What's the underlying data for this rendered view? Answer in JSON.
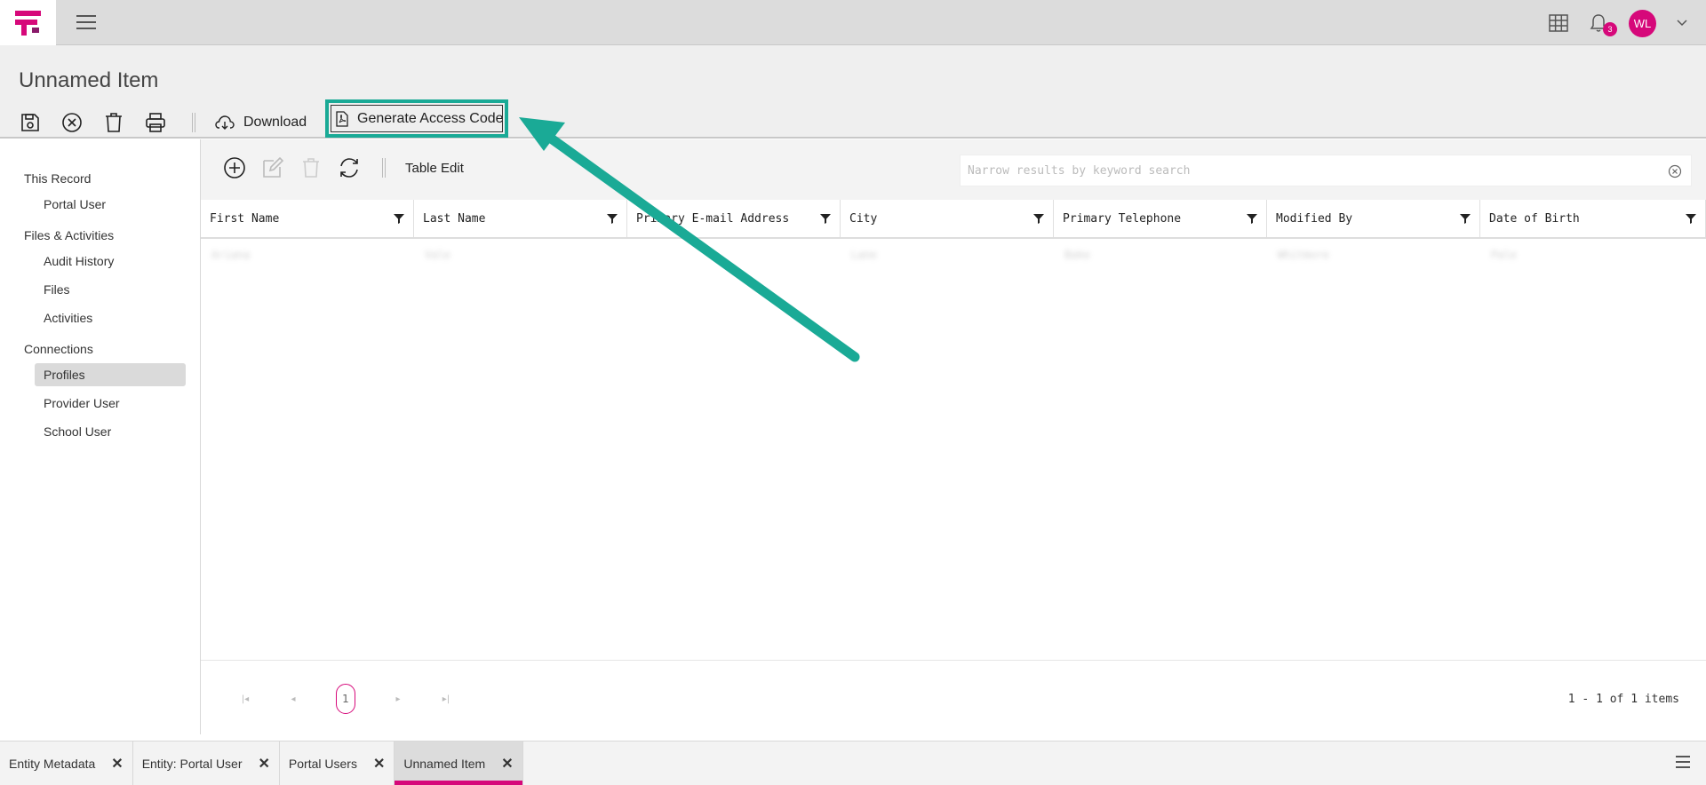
{
  "app": {
    "notification_count": "3",
    "user_initials": "WL",
    "accent_color": "#d6087a",
    "highlight_color": "#1aaa96"
  },
  "header": {
    "title": "Unnamed Item",
    "toolbar": {
      "icons": [
        "save-icon",
        "cancel-icon",
        "delete-icon",
        "print-icon"
      ],
      "download_label": "Download",
      "generate_label": "Generate Access Code"
    }
  },
  "sidebar": {
    "groups": [
      {
        "label": "This Record",
        "items": [
          "Portal User"
        ]
      },
      {
        "label": "Files & Activities",
        "items": [
          "Audit History",
          "Files",
          "Activities"
        ]
      },
      {
        "label": "Connections",
        "items": [
          "Profiles",
          "Provider User",
          "School User"
        ]
      }
    ],
    "active_item": "Profiles"
  },
  "grid": {
    "toolbar": {
      "icons": [
        "add-icon",
        "edit-icon",
        "delete-icon",
        "refresh-icon"
      ],
      "table_edit_label": "Table Edit"
    },
    "search": {
      "placeholder": "Narrow results by keyword search",
      "value": ""
    },
    "columns": [
      "First Name",
      "Last Name",
      "Primary E-mail Address",
      "City",
      "Primary Telephone",
      "Modified By",
      "Date of Birth"
    ],
    "rows": [
      [
        "Ariana",
        "Vale",
        "",
        "Lane",
        "Bake",
        "Whitmore",
        "Pale"
      ]
    ],
    "pager": {
      "current_page": "1",
      "info": "1 - 1 of 1 items"
    }
  },
  "tabs": [
    {
      "label": "Entity Metadata",
      "active": false
    },
    {
      "label": "Entity: Portal User",
      "active": false
    },
    {
      "label": "Portal Users",
      "active": false
    },
    {
      "label": "Unnamed Item",
      "active": true
    }
  ]
}
